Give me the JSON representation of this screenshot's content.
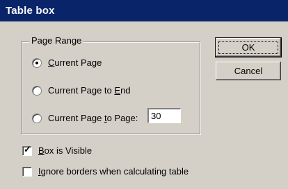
{
  "window": {
    "title": "Table box"
  },
  "page_range": {
    "label": "Page Range",
    "options": [
      {
        "pre": "",
        "key": "C",
        "post": "urrent Page",
        "checked": true
      },
      {
        "pre": "Current Page to ",
        "key": "E",
        "post": "nd",
        "checked": false
      },
      {
        "pre": "Current Page ",
        "key": "t",
        "post": "o Page:",
        "checked": false
      }
    ],
    "to_page_value": "30"
  },
  "buttons": {
    "ok": "OK",
    "cancel": "Cancel"
  },
  "options": {
    "box_visible": {
      "key": "B",
      "post": "ox is Visible",
      "checked": true
    },
    "ignore_borders": {
      "key": "I",
      "post": "gnore borders when calculating table",
      "checked": false
    }
  }
}
